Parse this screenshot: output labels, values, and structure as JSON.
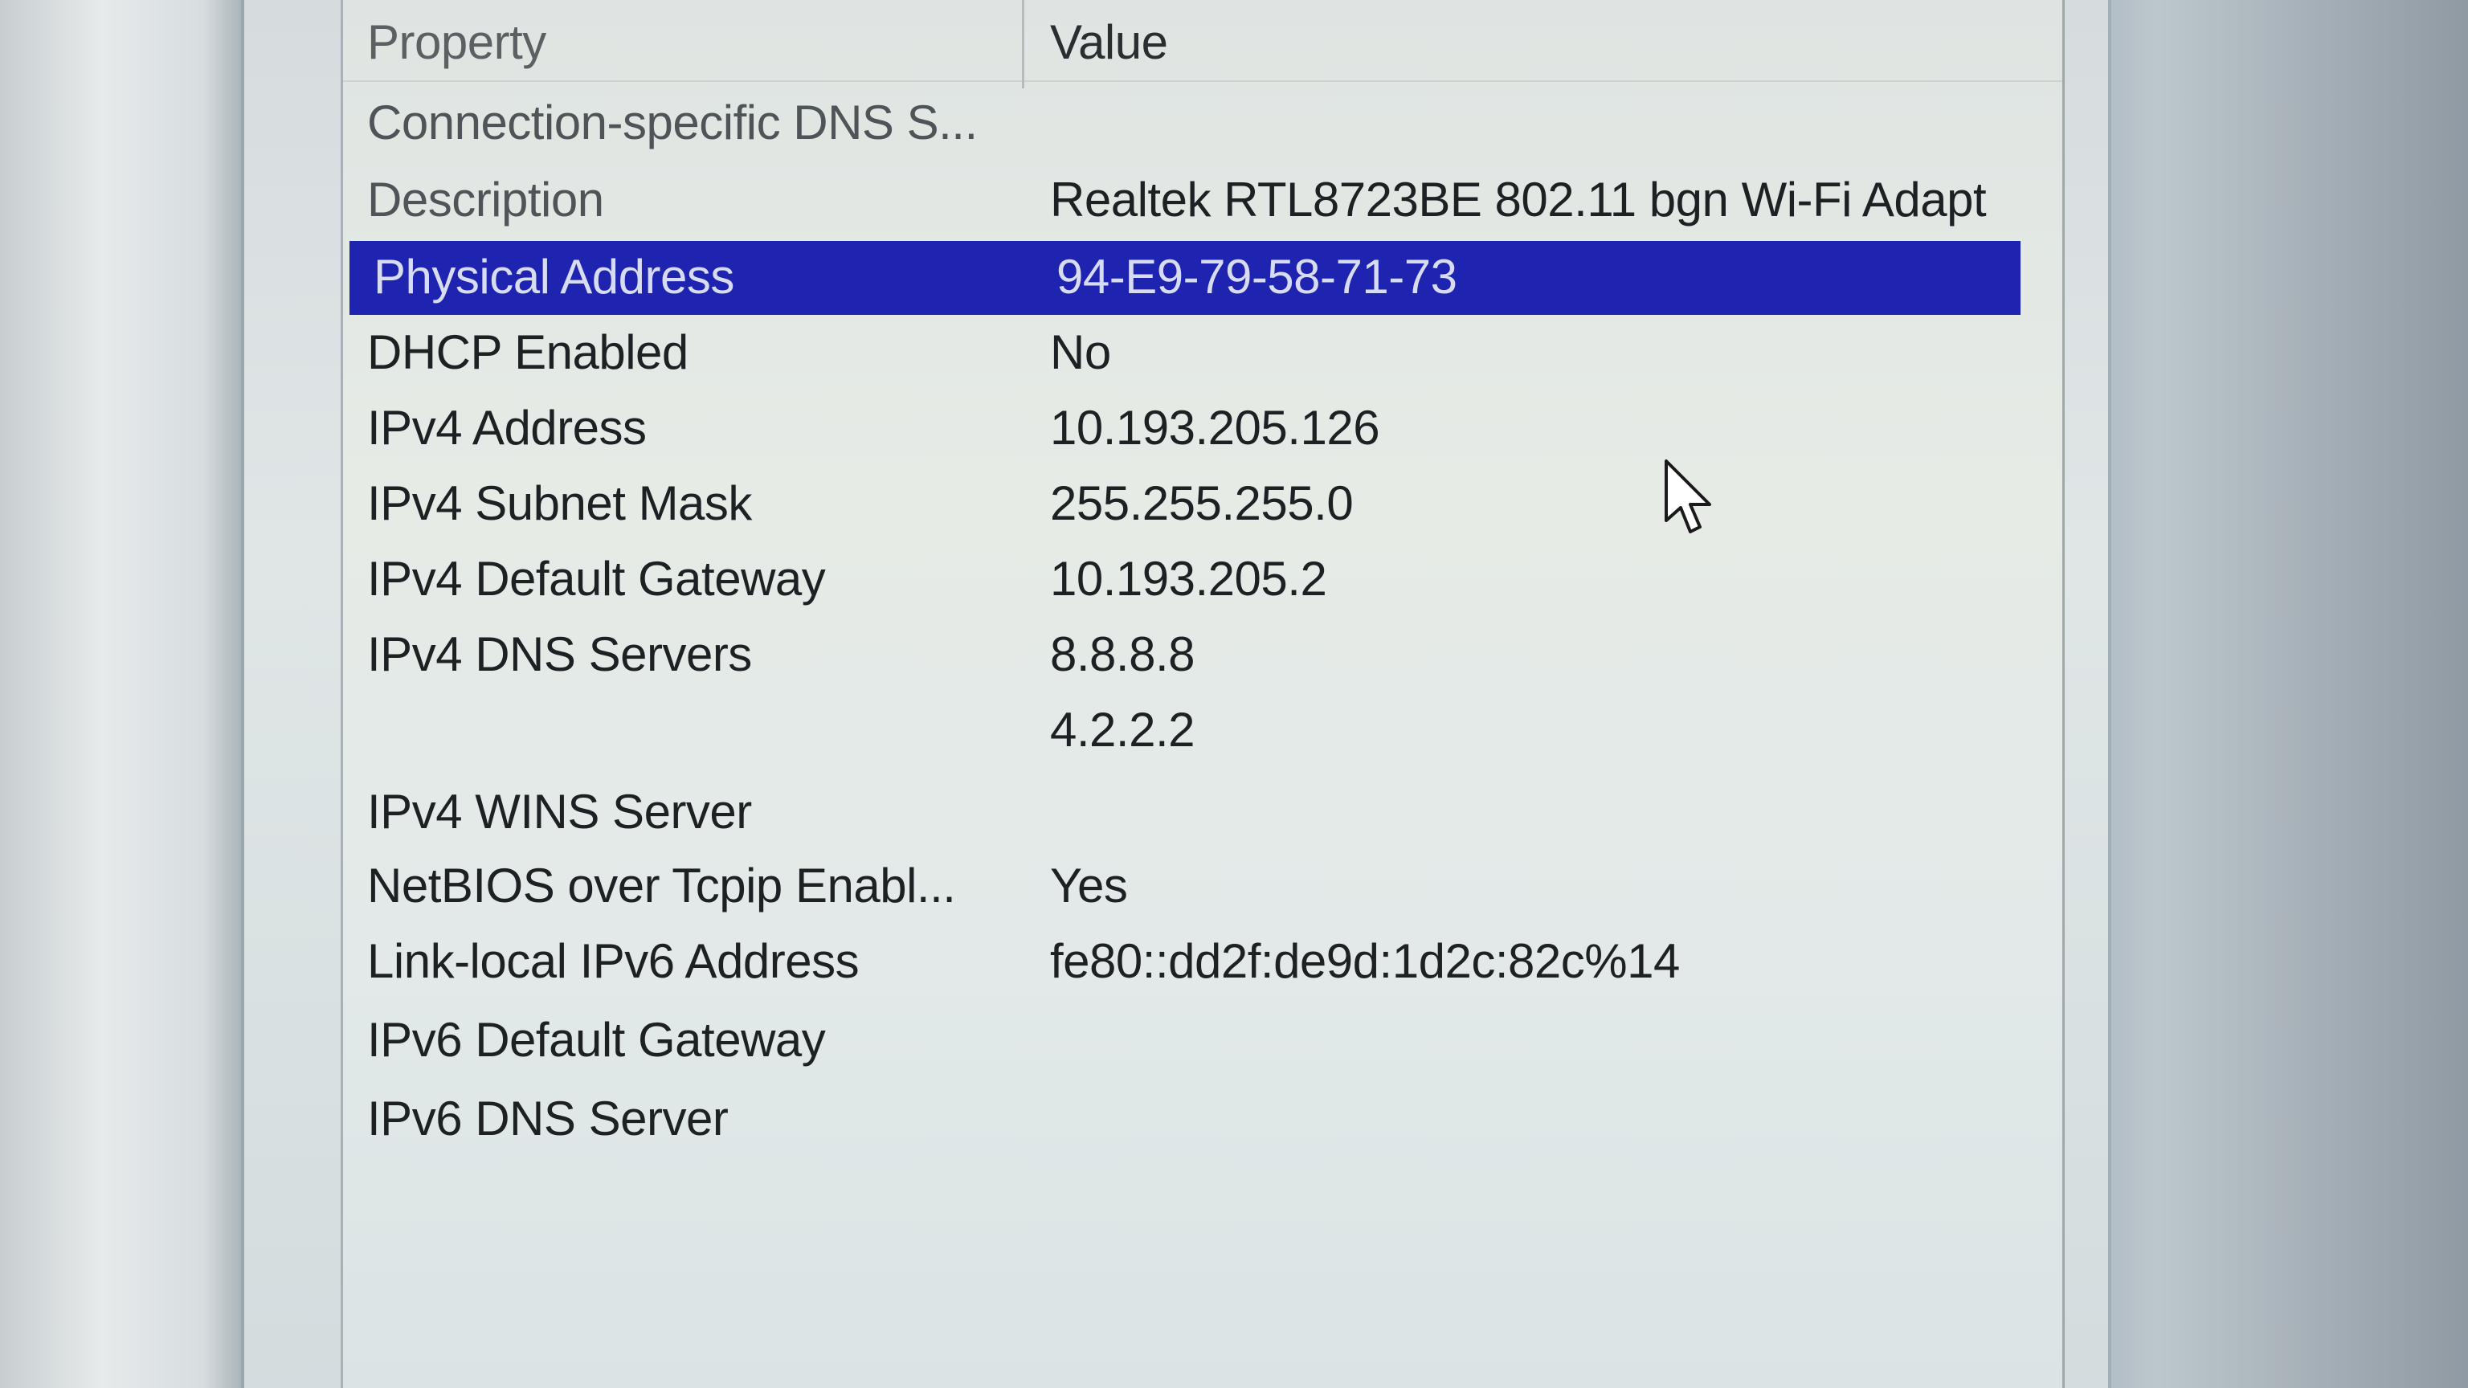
{
  "listview": {
    "columns": {
      "property": "Property",
      "value": "Value"
    },
    "rows": [
      {
        "property": "Connection-specific DNS S...",
        "value": ""
      },
      {
        "property": "Description",
        "value": "Realtek RTL8723BE 802.11 bgn Wi-Fi Adapt"
      },
      {
        "property": "Physical Address",
        "value": "94-E9-79-58-71-73",
        "selected": true
      },
      {
        "property": "DHCP Enabled",
        "value": "No"
      },
      {
        "property": "IPv4 Address",
        "value": "10.193.205.126"
      },
      {
        "property": "IPv4 Subnet Mask",
        "value": "255.255.255.0"
      },
      {
        "property": "IPv4 Default Gateway",
        "value": "10.193.205.2"
      },
      {
        "property": "IPv4 DNS Servers",
        "value": "8.8.8.8"
      },
      {
        "property": "",
        "value": "4.2.2.2"
      },
      {
        "property": "IPv4 WINS Server",
        "value": ""
      },
      {
        "property": "NetBIOS over Tcpip Enabl...",
        "value": "Yes"
      },
      {
        "property": "Link-local IPv6 Address",
        "value": "fe80::dd2f:de9d:1d2c:82c%14"
      },
      {
        "property": "IPv6 Default Gateway",
        "value": ""
      },
      {
        "property": "IPv6 DNS Server",
        "value": ""
      }
    ]
  },
  "colors": {
    "selection": "#1e23b0",
    "selected_text": "#d8dcf2",
    "text": "#1d2124"
  },
  "cursor": {
    "icon": "arrow-cursor-icon"
  }
}
